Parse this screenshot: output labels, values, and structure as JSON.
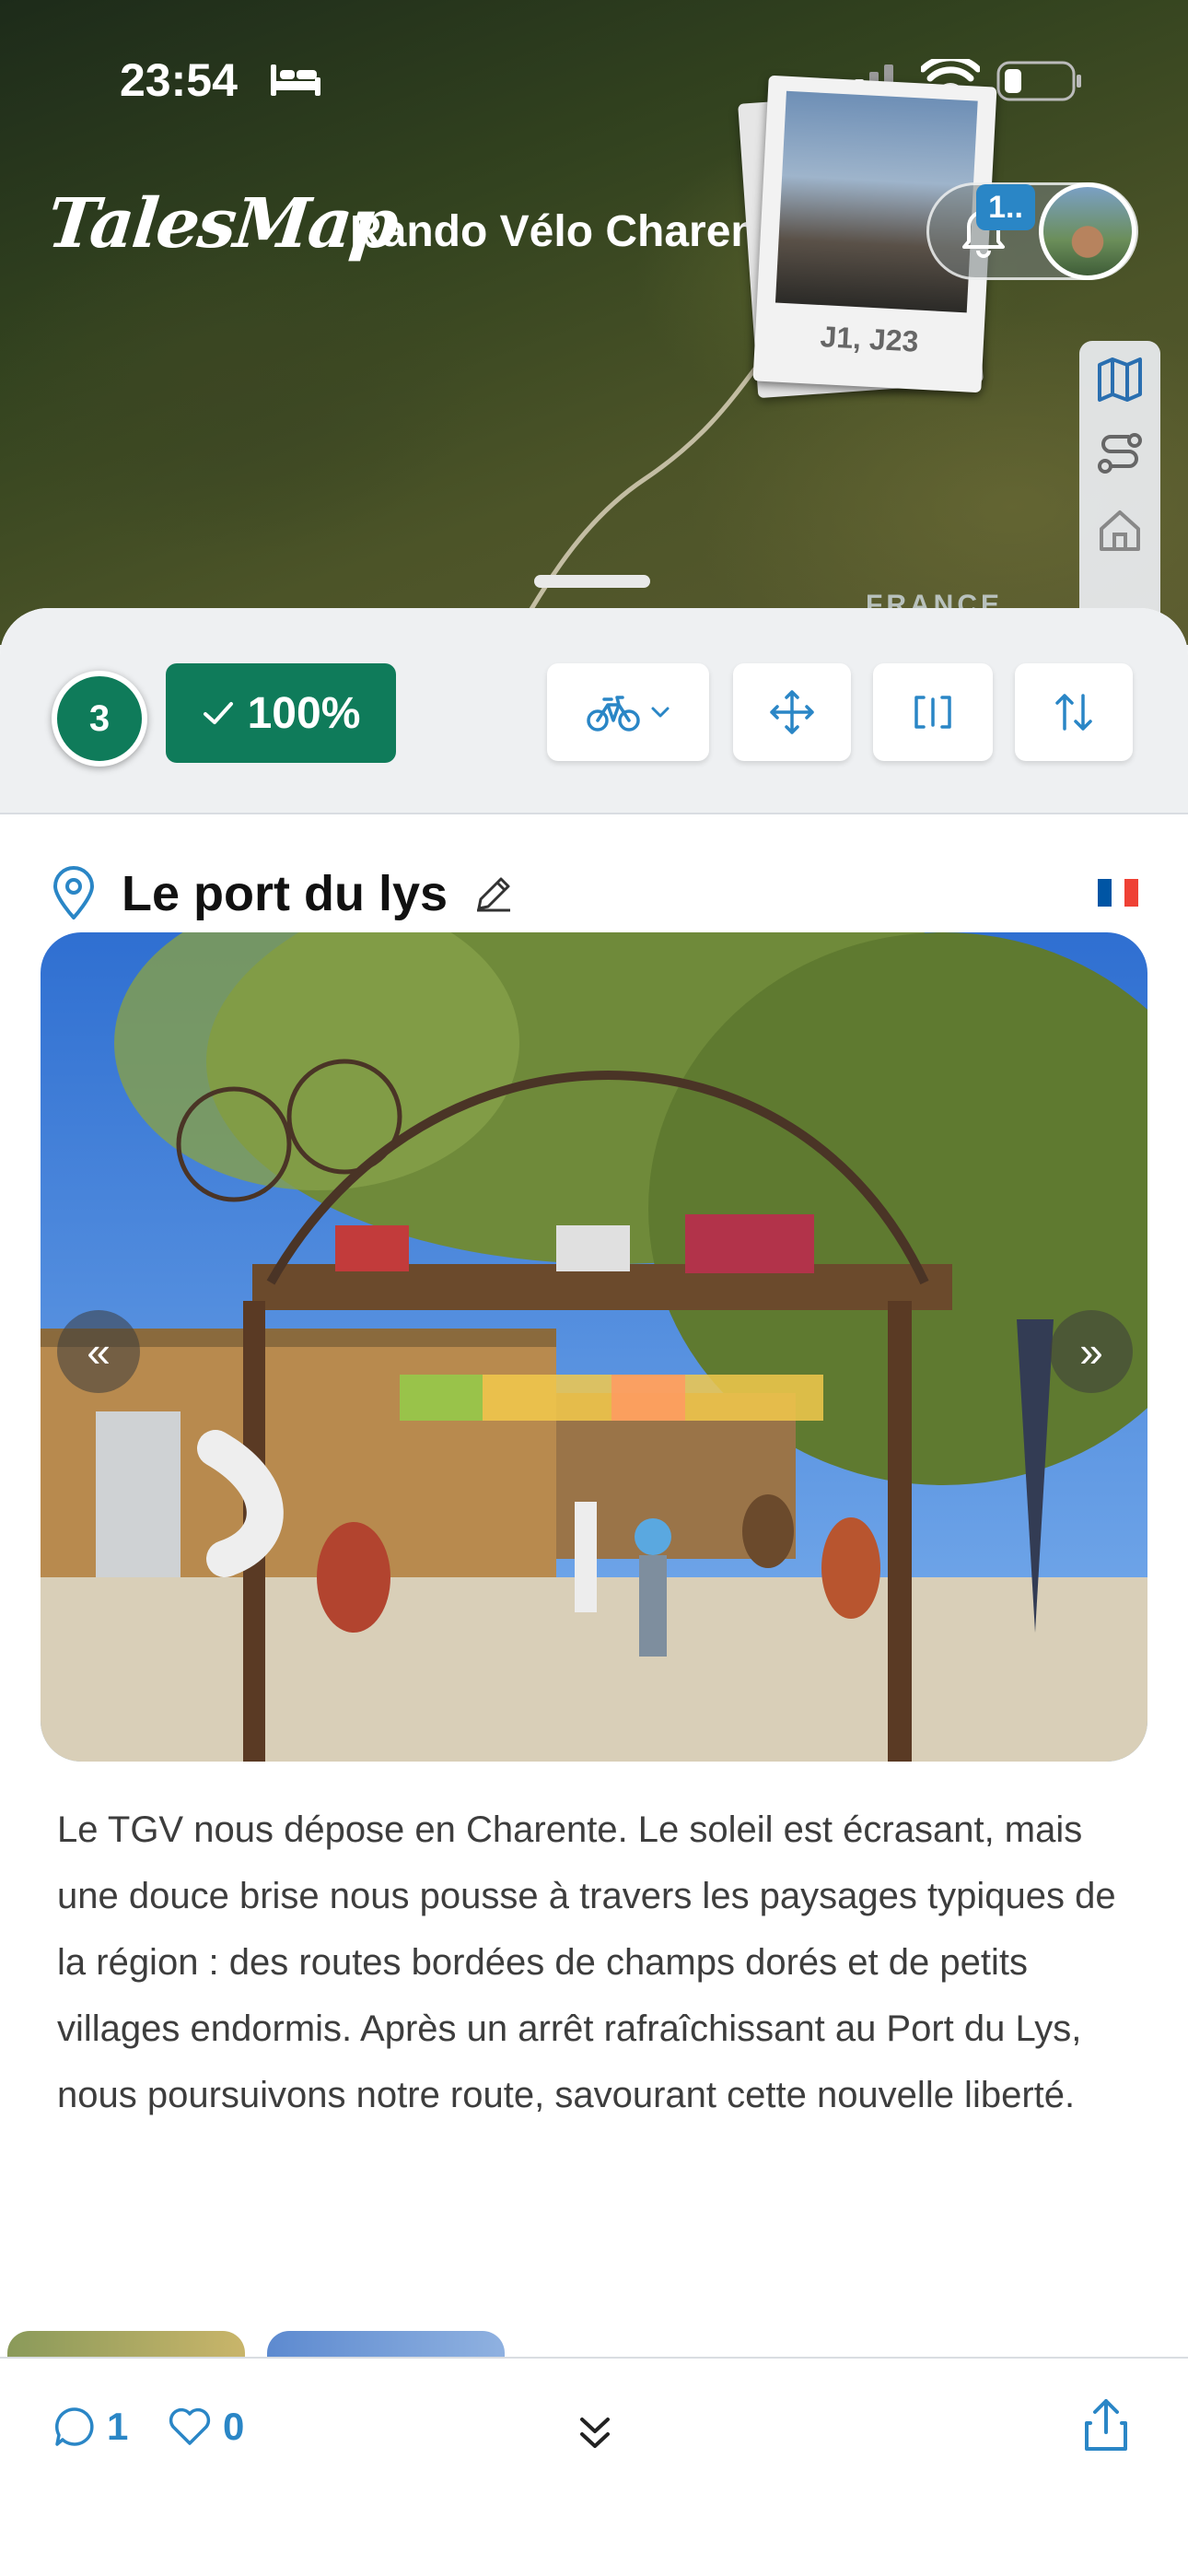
{
  "status_bar": {
    "time": "23:54"
  },
  "header": {
    "logo_text": "TalesMap",
    "trip_title": "Rando Vélo Charentes",
    "notification_count": "1..",
    "polaroid_caption": "J1, J23"
  },
  "map": {
    "country_label": "FRANCE"
  },
  "toolbar": {
    "step_number": "3",
    "progress": "100%"
  },
  "place": {
    "title": "Le port du lys",
    "flag_colors": [
      "#0055a4",
      "#ffffff",
      "#ef4135"
    ]
  },
  "description": "Le TGV nous dépose en Charente. Le soleil est écrasant, mais une douce brise nous pousse à travers les paysages typiques de la région : des routes bordées de champs dorés et de petits villages endormis. Après un arrêt rafraîchissant au Port du Lys, nous poursuivons notre route, savourant cette nouvelle liberté.",
  "bottom_bar": {
    "comments_count": "1",
    "likes_count": "0"
  },
  "colors": {
    "accent_green": "#0f7b5a",
    "accent_blue": "#2a86c6"
  }
}
